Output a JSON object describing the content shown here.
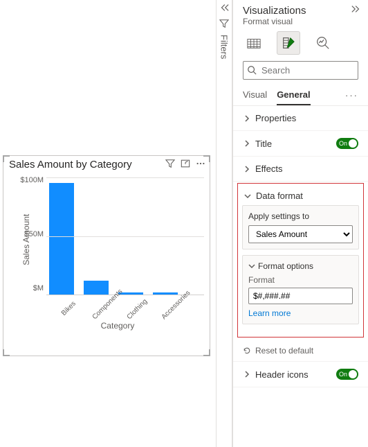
{
  "chart_data": {
    "type": "bar",
    "title": "Sales Amount by Category",
    "xlabel": "Category",
    "ylabel": "Sales Amount",
    "categories": [
      "Bikes",
      "Components",
      "Clothing",
      "Accessories"
    ],
    "values": [
      95000000,
      12000000,
      2000000,
      1500000
    ],
    "ylim": [
      0,
      100000000
    ],
    "yticks": [
      "$100M",
      "$50M",
      "$M"
    ]
  },
  "filters": {
    "label": "Filters"
  },
  "viz": {
    "title": "Visualizations",
    "subtitle": "Format visual",
    "search_placeholder": "Search",
    "tabs": {
      "visual": "Visual",
      "general": "General"
    },
    "sections": {
      "properties": "Properties",
      "title": "Title",
      "title_toggle": "On",
      "effects": "Effects",
      "data_format": "Data format",
      "apply_label": "Apply settings to",
      "apply_value": "Sales Amount",
      "format_options": "Format options",
      "format_label": "Format",
      "format_value": "$#,###.##",
      "learn_more": "Learn more",
      "reset": "Reset to default",
      "header_icons": "Header icons",
      "header_toggle": "On"
    }
  }
}
